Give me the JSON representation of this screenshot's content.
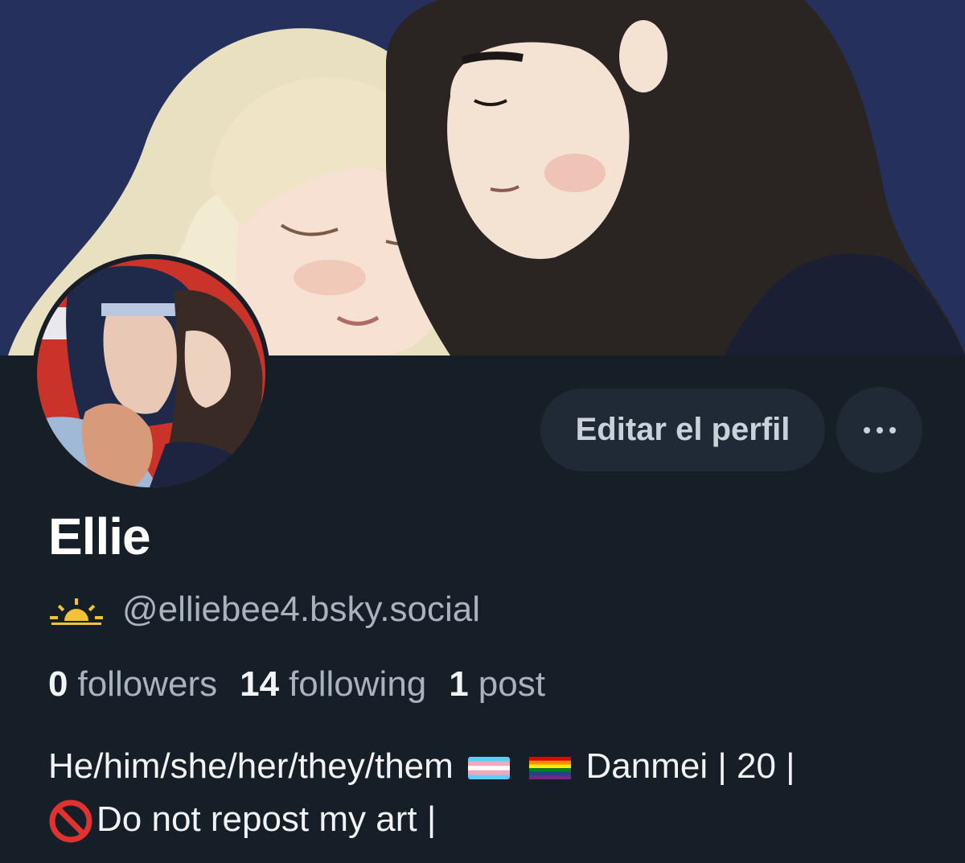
{
  "profile": {
    "display_name": "Ellie",
    "handle": "@elliebee4.bsky.social",
    "handle_prefix_icon": "sunrise-icon",
    "edit_label": "Editar el perfil",
    "more_icon": "ellipsis-icon",
    "stats": {
      "followers_count": "0",
      "followers_label": "followers",
      "following_count": "14",
      "following_label": "following",
      "posts_count": "1",
      "posts_label": "post"
    },
    "bio": {
      "line1_text": "He/him/she/her/they/them",
      "line1_flags": [
        "transgender-flag-icon",
        "rainbow-flag-icon"
      ],
      "line1_rest": "Danmei | 20 |",
      "line2_icon": "prohibited-icon",
      "line2_text": "Do not repost my art |"
    }
  },
  "colors": {
    "background": "#161e27",
    "banner_bg": "#25315c",
    "button_bg": "#1f2a36",
    "muted_text": "#a8b3bf",
    "sun_icon": "#f1c232"
  }
}
